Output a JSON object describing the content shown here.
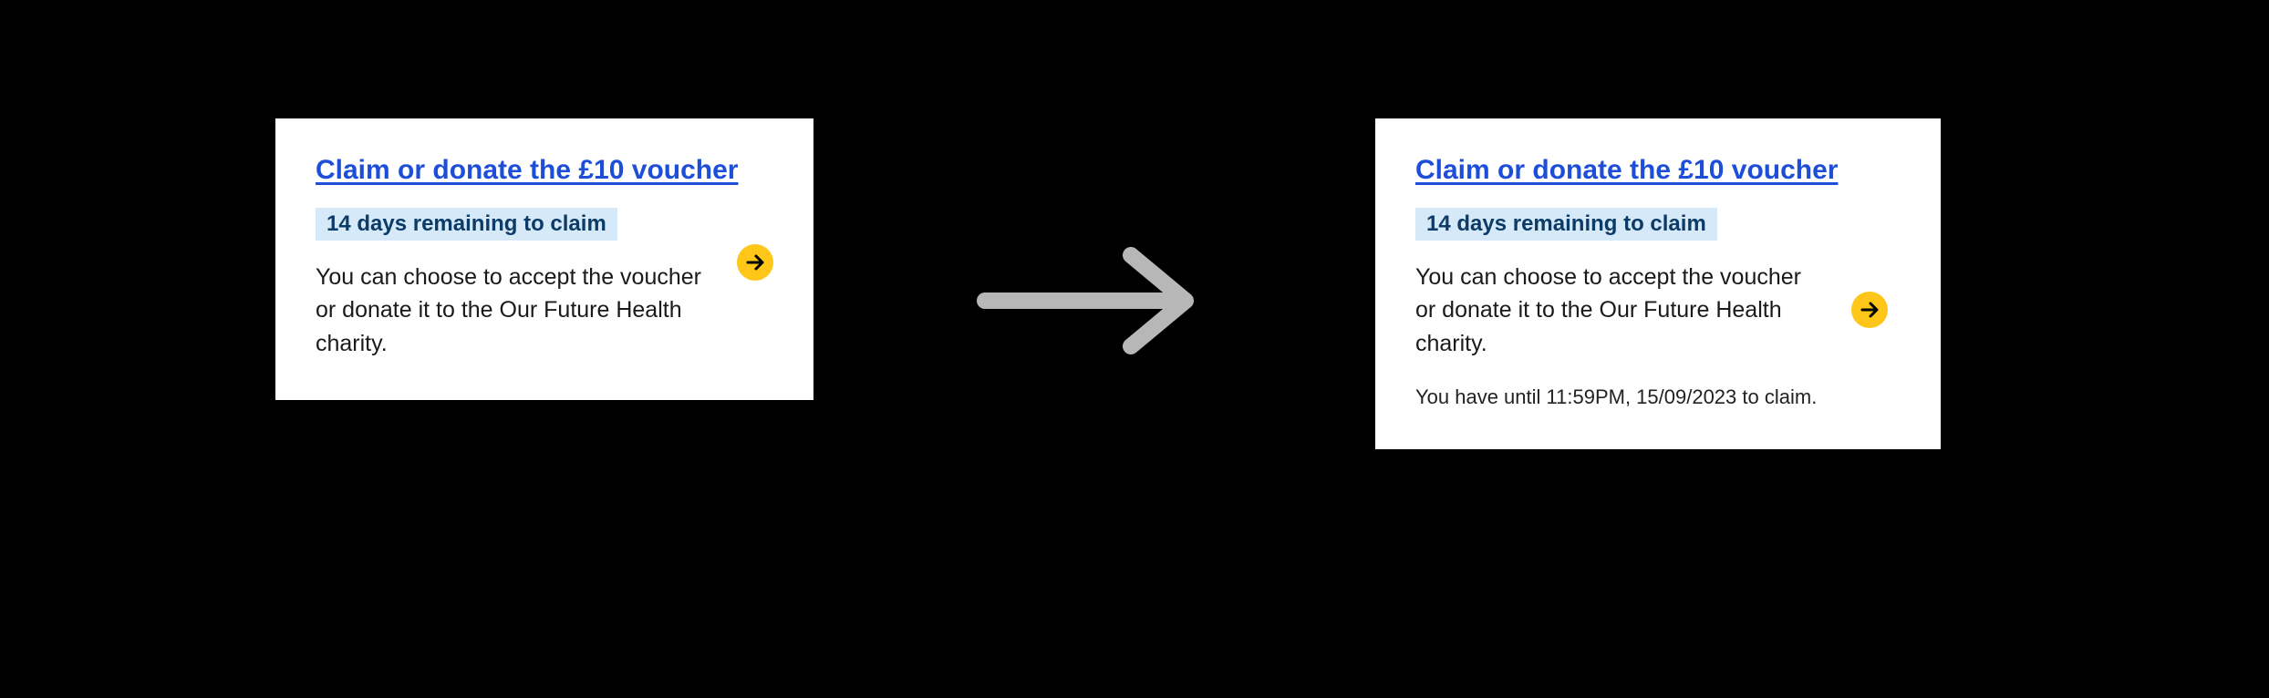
{
  "before": {
    "title": "Claim or donate the £10 voucher",
    "badge": "14 days remaining to claim",
    "body": "You can choose to accept the voucher or donate it to the Our Future Health charity."
  },
  "after": {
    "title": "Claim or donate the £10 voucher",
    "badge": "14 days remaining to claim",
    "body": "You can choose to accept the voucher or donate it to the Our Future Health charity.",
    "subtext": "You have until 11:59PM, 15/09/2023 to claim."
  }
}
